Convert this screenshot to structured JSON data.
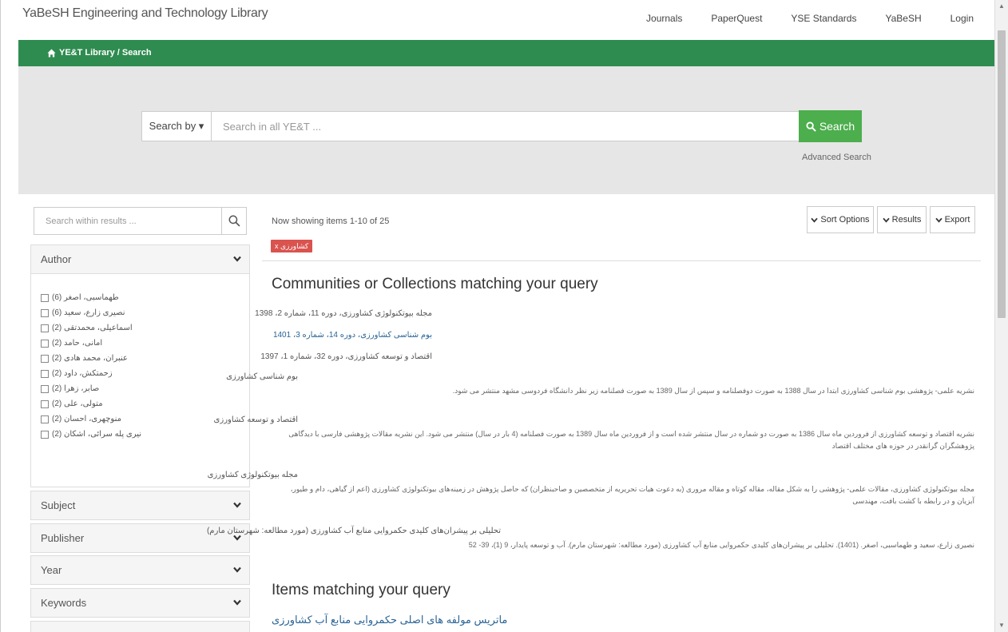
{
  "brand": "YaBeSH Engineering and Technology Library",
  "nav": [
    "Journals",
    "PaperQuest",
    "YSE Standards",
    "YaBeSH",
    "Login"
  ],
  "breadcrumb": "YE&T Library  /  Search",
  "search": {
    "searchby_label": "Search by ▾",
    "placeholder": "Search in all YE&T ...",
    "button_label": "Search",
    "advanced": "Advanced Search"
  },
  "sidebar": {
    "search_placeholder": "Search within results ...",
    "facets": [
      "Author",
      "Subject",
      "Publisher",
      "Year",
      "Keywords"
    ],
    "authors": [
      "طهماسبی، اصغر (6)",
      "نصیری زارع، سعید (6)",
      "اسماعیلی، محمدتقی (2)",
      "امانی، حامد (2)",
      "عنبران، محمد هادی (2)",
      "زحمتکش، داود (2)",
      "صابر، زهرا (2)",
      "متولی، علی (2)",
      "منوچهری، احسان (2)",
      "نیری پله سرائی، اشکان (2)"
    ]
  },
  "results": {
    "showing": "Now showing items 1-10 of 25",
    "tag": "x کشاورزی",
    "buttons": [
      "Sort Options",
      "Results",
      "Export"
    ],
    "communities_heading": "Communities or Collections matching your query",
    "collection_links": [
      "مجله بیوتکنولوژی کشاورزی، دوره 11، شماره 2، 1398",
      "بوم شناسی کشاورزی، دوره 14، شماره 3، 1401",
      "اقتصاد و توسعه کشاورزی، دوره 32، شماره 1، 1397"
    ],
    "collections": [
      {
        "title": "بوم شناسی کشاورزی",
        "desc": "نشریه علمی- پژوهشی بوم شناسی کشاورزی ابتدا در سال 1388 به صورت دوفصلنامه و سپس از سال 1389 به صورت فصلنامه زیر نظر دانشگاه فردوسی مشهد منتشر می شود."
      },
      {
        "title": "اقتصاد و توسعه کشاورزی",
        "desc": "نشریه اقتصاد و توسعه کشاورزی از فروردین ماه سال 1386 به صورت دو شماره در سال منتشر شده است و از فروردین ماه سال 1389 به صورت فصلنامه (4 بار در سال) منتشر می شود. این نشریه مقالات پژوهشی فارسی با دیدگاهی پژوهشگران گرانقدر در حوزه های مختلف اقتصاد"
      },
      {
        "title": "مجله بیوتکنولوژی کشاورزی",
        "desc": "مجله بیوتکنولوژی کشاورزی، مقالات علمی- پژوهشی را به شکل مقاله، مقاله کوتاه و مقاله مروری (به دعوت هیات تحریریه از متخصصین و صاحبنظران) که حاصل پژوهش در زمینه‌های بیوتکنولوژی کشاورزی (اعم از گیاهی، دام و طیور، آبزیان و در رابطه با کشت بافت، مهندسی"
      },
      {
        "title": "تحلیلی بر پیشران‌های کلیدی حکمروایی منابع آب کشاورزی (مورد مطالعه: شهرستان مارم)",
        "desc": "نصیری زارع، سعید و طهماسبی، اصغر. (1401). تحلیلی بر پیشران‌های کلیدی حکمروایی منابع آب کشاورزی (مورد مطالعه: شهرستان مارم). آب و توسعه پایدار، 9 (1)، 39- 52"
      }
    ],
    "items_heading": "Items matching your query",
    "first_item": "ماتریس مولفه های اصلی حکمروایی منابع آب کشاورزی"
  }
}
